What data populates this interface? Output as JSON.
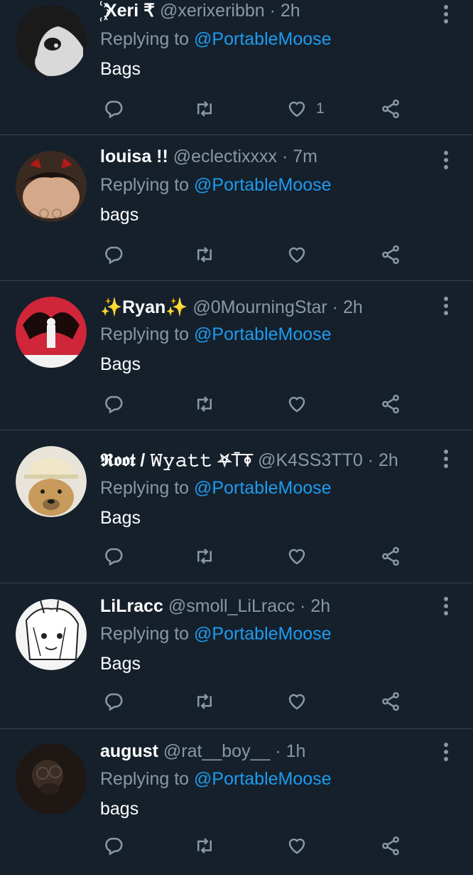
{
  "tweets": [
    {
      "name": "꙰ Xeri ₹",
      "handle": "@xerixeribbn",
      "dot": "·",
      "time": "2h",
      "reply_prefix": "Replying to",
      "reply_to": "@PortableMoose",
      "text": "Bags",
      "likes": "1"
    },
    {
      "name": "louisa !!",
      "handle": "@eclectixxxx",
      "dot": "·",
      "time": "7m",
      "reply_prefix": "Replying to",
      "reply_to": "@PortableMoose",
      "text": "bags",
      "likes": ""
    },
    {
      "name": "✨Ryan✨",
      "handle": "@0MourningStar",
      "dot": "·",
      "time": "2h",
      "reply_prefix": "Replying to",
      "reply_to": "@PortableMoose",
      "text": "Bags",
      "likes": ""
    },
    {
      "name": "𝕽𝖔𝖔𝖙 / 𝚆𝚢𝚊𝚝𝚝 ⛧⍑⍕",
      "handle": "@K4SS3TT0",
      "dot": "·",
      "time": "2h",
      "reply_prefix": "Replying to",
      "reply_to": "@PortableMoose",
      "text": "Bags",
      "likes": ""
    },
    {
      "name": "LiLracc",
      "handle": "@smoll_LiLracc",
      "dot": "·",
      "time": "2h",
      "reply_prefix": "Replying to",
      "reply_to": "@PortableMoose",
      "text": "Bags",
      "likes": ""
    },
    {
      "name": "august",
      "handle": "@rat__boy__",
      "dot": "·",
      "time": "1h",
      "reply_prefix": "Replying to",
      "reply_to": "@PortableMoose",
      "text": "bags",
      "likes": ""
    }
  ],
  "icons": {
    "reply": "reply-icon",
    "retweet": "retweet-icon",
    "like": "heart-icon",
    "share": "share-icon",
    "more": "more-vertical-icon"
  },
  "colors": {
    "background": "#15202b",
    "secondary_text": "#8899a6",
    "link": "#1d9bf0",
    "divider": "#38444d"
  }
}
